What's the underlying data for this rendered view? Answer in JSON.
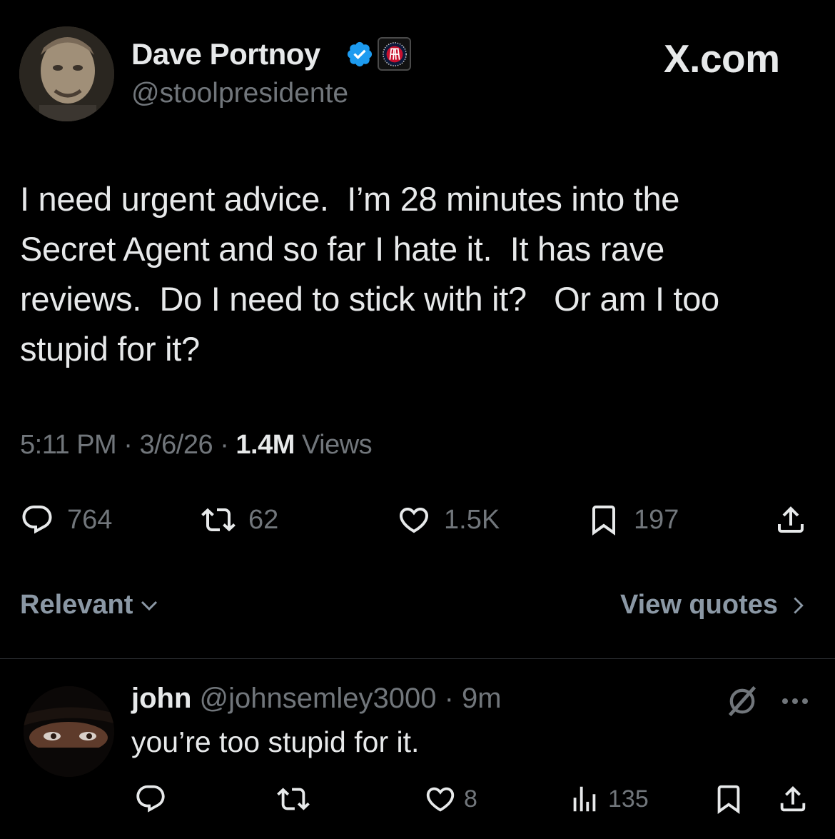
{
  "colors": {
    "background": "#000000",
    "text_primary": "#e7e9ea",
    "text_secondary": "#71767b",
    "verified_blue": "#1d9bf0",
    "divider": "#2f3336"
  },
  "header": {
    "display_name": "Dave Portnoy",
    "handle": "@stoolpresidente",
    "verified_icon": "verified-badge-icon",
    "affiliation_icon": "barstool-logo-icon",
    "brand": "X.com"
  },
  "tweet": {
    "text": "I need urgent advice.  I’m 28 minutes into the\nSecret Agent and so far I hate it.  It has rave\nreviews.  Do I need to stick with it?   Or am I too\nstupid for it?",
    "time": "5:11 PM",
    "sep1": " · ",
    "date": "3/6/26",
    "sep2": " · ",
    "views_count": "1.4M",
    "views_label": " Views"
  },
  "actions": {
    "replies": "764",
    "reposts": "62",
    "likes": "1.5K",
    "bookmarks": "197"
  },
  "sort": {
    "label": "Relevant",
    "quotes_label": "View quotes"
  },
  "reply": {
    "name": "john",
    "handle": "@johnsemley3000",
    "sep": " · ",
    "time": "9m",
    "text": "you’re too stupid for it.",
    "likes": "8",
    "views": "135"
  }
}
